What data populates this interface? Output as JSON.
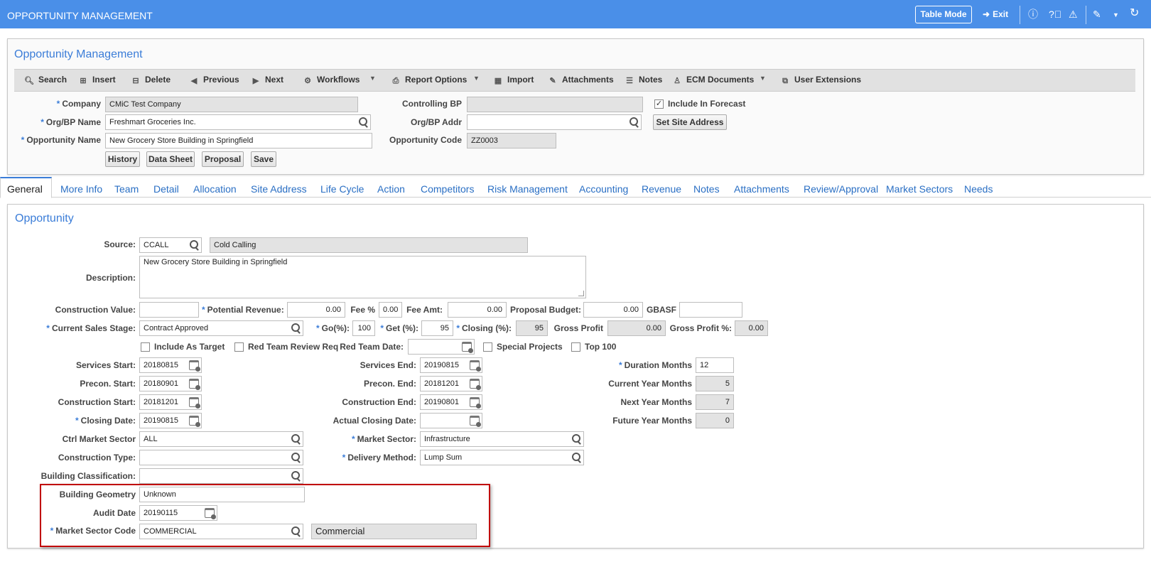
{
  "app": {
    "title": "OPPORTUNITY MANAGEMENT",
    "table_mode": "Table Mode",
    "exit": "Exit"
  },
  "header": {
    "title": "Opportunity Management",
    "toolbar": {
      "search": "Search",
      "insert": "Insert",
      "delete": "Delete",
      "previous": "Previous",
      "next": "Next",
      "workflows": "Workflows",
      "report_options": "Report Options",
      "import": "Import",
      "attachments": "Attachments",
      "notes": "Notes",
      "ecm_documents": "ECM Documents",
      "user_extensions": "User Extensions"
    },
    "labels": {
      "company": "Company",
      "org_bp_name": "Org/BP Name",
      "opportunity_name": "Opportunity Name",
      "controlling_bp": "Controlling BP",
      "org_bp_addr": "Org/BP Addr",
      "opportunity_code": "Opportunity Code",
      "include_in_forecast": "Include In Forecast"
    },
    "values": {
      "company": "CMiC Test Company",
      "org_bp_name": "Freshmart Groceries Inc.",
      "opportunity_name": "New Grocery Store Building in Springfield",
      "controlling_bp": "",
      "org_bp_addr": "",
      "opportunity_code": "ZZ0003"
    },
    "buttons": {
      "set_site_address": "Set Site Address",
      "history": "History",
      "data_sheet": "Data Sheet",
      "proposal": "Proposal",
      "save": "Save"
    }
  },
  "tabs": [
    "General",
    "More Info",
    "Team",
    "Detail",
    "Allocation",
    "Site Address",
    "Life Cycle",
    "Action",
    "Competitors",
    "Risk Management",
    "Accounting",
    "Revenue",
    "Notes",
    "Attachments",
    "Review/Approval",
    "Market Sectors",
    "Needs"
  ],
  "opportunity": {
    "title": "Opportunity",
    "labels": {
      "source": "Source:",
      "description": "Description:",
      "construction_value": "Construction Value:",
      "potential_revenue": "Potential Revenue:",
      "fee_pct": "Fee %",
      "fee_amt": "Fee Amt:",
      "proposal_budget": "Proposal Budget:",
      "gbasf": "GBASF",
      "current_sales_stage": "Current Sales Stage:",
      "go_pct": "Go(%):",
      "get_pct": "Get (%):",
      "closing_pct": "Closing (%):",
      "gross_profit": "Gross Profit",
      "gross_profit_pct": "Gross Profit %:",
      "include_as_target": "Include As Target",
      "red_team_review_req": "Red Team Review Req",
      "red_team_date": "Red Team Date:",
      "special_projects": "Special Projects",
      "top_100": "Top 100",
      "services_start": "Services Start:",
      "services_end": "Services End:",
      "duration_months": "Duration Months",
      "precon_start": "Precon. Start:",
      "precon_end": "Precon. End:",
      "current_year_months": "Current Year Months",
      "construction_start": "Construction Start:",
      "construction_end": "Construction End:",
      "next_year_months": "Next Year Months",
      "closing_date": "Closing Date:",
      "actual_closing_date": "Actual Closing Date:",
      "future_year_months": "Future Year Months",
      "ctrl_market_sector": "Ctrl Market Sector",
      "market_sector": "Market Sector:",
      "construction_type": "Construction Type:",
      "delivery_method": "Delivery Method:",
      "building_classification": "Building Classification:",
      "building_geometry": "Building Geometry",
      "audit_date": "Audit Date",
      "market_sector_code": "Market Sector Code"
    },
    "values": {
      "source": "CCALL",
      "source_desc": "Cold Calling",
      "description": "New Grocery Store Building in Springfield",
      "construction_value": "",
      "potential_revenue": "0.00",
      "fee_pct": "0.00",
      "fee_amt": "0.00",
      "proposal_budget": "0.00",
      "gbasf": "",
      "current_sales_stage": "Contract Approved",
      "go_pct": "100",
      "get_pct": "95",
      "closing_pct": "95",
      "gross_profit": "0.00",
      "gross_profit_pct": "0.00",
      "red_team_date": "",
      "services_start": "20180815",
      "services_end": "20190815",
      "duration_months": "12",
      "precon_start": "20180901",
      "precon_end": "20181201",
      "current_year_months": "5",
      "construction_start": "20181201",
      "construction_end": "20190801",
      "next_year_months": "7",
      "closing_date": "20190815",
      "actual_closing_date": "",
      "future_year_months": "0",
      "ctrl_market_sector": "ALL",
      "market_sector": "Infrastructure",
      "construction_type": "",
      "delivery_method": "Lump Sum",
      "building_classification": "",
      "building_geometry": "Unknown",
      "audit_date": "20190115",
      "market_sector_code": "COMMERCIAL",
      "market_sector_code_desc": "Commercial"
    },
    "checkboxes": {
      "include_in_forecast": true,
      "include_as_target": false,
      "red_team_review_req": false,
      "special_projects": false,
      "top_100": false
    }
  }
}
